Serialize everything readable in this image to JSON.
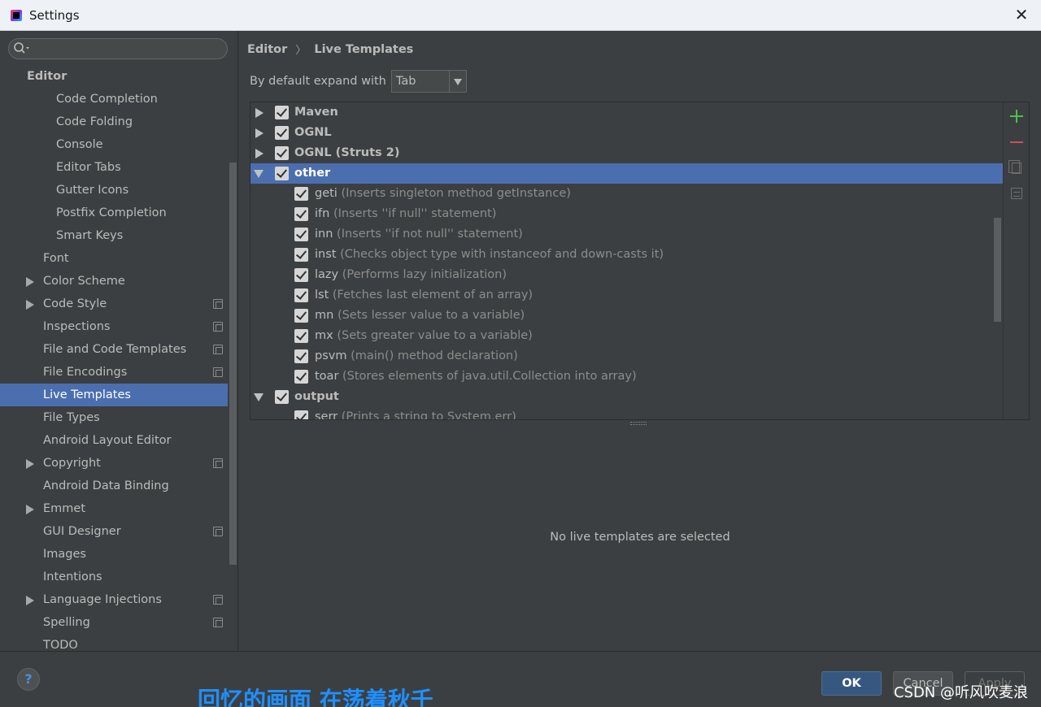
{
  "window": {
    "title": "Settings",
    "close_glyph": "✕"
  },
  "search": {
    "placeholder": ""
  },
  "sidebar": {
    "items": [
      {
        "label": "Editor",
        "kind": "header"
      },
      {
        "label": "Code Completion",
        "kind": "lvl2"
      },
      {
        "label": "Code Folding",
        "kind": "lvl2"
      },
      {
        "label": "Console",
        "kind": "lvl2"
      },
      {
        "label": "Editor Tabs",
        "kind": "lvl2"
      },
      {
        "label": "Gutter Icons",
        "kind": "lvl2"
      },
      {
        "label": "Postfix Completion",
        "kind": "lvl2"
      },
      {
        "label": "Smart Keys",
        "kind": "lvl2"
      },
      {
        "label": "Font",
        "kind": "lvl1"
      },
      {
        "label": "Color Scheme",
        "kind": "lvl1",
        "arrow": true
      },
      {
        "label": "Code Style",
        "kind": "lvl1",
        "arrow": true,
        "proj": true
      },
      {
        "label": "Inspections",
        "kind": "lvl1",
        "proj": true
      },
      {
        "label": "File and Code Templates",
        "kind": "lvl1",
        "proj": true
      },
      {
        "label": "File Encodings",
        "kind": "lvl1",
        "proj": true
      },
      {
        "label": "Live Templates",
        "kind": "lvl1",
        "selected": true
      },
      {
        "label": "File Types",
        "kind": "lvl1"
      },
      {
        "label": "Android Layout Editor",
        "kind": "lvl1"
      },
      {
        "label": "Copyright",
        "kind": "lvl1",
        "arrow": true,
        "proj": true
      },
      {
        "label": "Android Data Binding",
        "kind": "lvl1"
      },
      {
        "label": "Emmet",
        "kind": "lvl1",
        "arrow": true
      },
      {
        "label": "GUI Designer",
        "kind": "lvl1",
        "proj": true
      },
      {
        "label": "Images",
        "kind": "lvl1"
      },
      {
        "label": "Intentions",
        "kind": "lvl1"
      },
      {
        "label": "Language Injections",
        "kind": "lvl1",
        "arrow": true,
        "proj": true
      },
      {
        "label": "Spelling",
        "kind": "lvl1",
        "proj": true
      },
      {
        "label": "TODO",
        "kind": "lvl1"
      }
    ]
  },
  "breadcrumb": {
    "part1": "Editor",
    "sep": "〉",
    "part2": "Live Templates"
  },
  "expand": {
    "label": "By default expand with",
    "value": "Tab"
  },
  "templates": [
    {
      "type": "group",
      "name": "Maven",
      "expanded": false,
      "checked": true
    },
    {
      "type": "group",
      "name": "OGNL",
      "expanded": false,
      "checked": true
    },
    {
      "type": "group",
      "name": "OGNL (Struts 2)",
      "expanded": false,
      "checked": true
    },
    {
      "type": "group",
      "name": "other",
      "expanded": true,
      "checked": true,
      "selected": true
    },
    {
      "type": "item",
      "abbr": "geti",
      "desc": "(Inserts singleton method getInstance)",
      "checked": true
    },
    {
      "type": "item",
      "abbr": "ifn",
      "desc": "(Inserts ''if null'' statement)",
      "checked": true
    },
    {
      "type": "item",
      "abbr": "inn",
      "desc": "(Inserts ''if not null'' statement)",
      "checked": true
    },
    {
      "type": "item",
      "abbr": "inst",
      "desc": "(Checks object type with instanceof and down-casts it)",
      "checked": true
    },
    {
      "type": "item",
      "abbr": "lazy",
      "desc": "(Performs lazy initialization)",
      "checked": true
    },
    {
      "type": "item",
      "abbr": "lst",
      "desc": "(Fetches last element of an array)",
      "checked": true
    },
    {
      "type": "item",
      "abbr": "mn",
      "desc": "(Sets lesser value to a variable)",
      "checked": true
    },
    {
      "type": "item",
      "abbr": "mx",
      "desc": "(Sets greater value to a variable)",
      "checked": true
    },
    {
      "type": "item",
      "abbr": "psvm",
      "desc": "(main() method declaration)",
      "checked": true
    },
    {
      "type": "item",
      "abbr": "toar",
      "desc": "(Stores elements of java.util.Collection into array)",
      "checked": true
    },
    {
      "type": "group",
      "name": "output",
      "expanded": true,
      "checked": true
    },
    {
      "type": "item",
      "abbr": "serr",
      "desc": "(Prints a string to System.err)",
      "checked": true
    }
  ],
  "empty_message": "No live templates are selected",
  "buttons": {
    "ok": "OK",
    "cancel": "Cancel",
    "apply": "Apply",
    "help": "?"
  },
  "overlay": {
    "subtitle": "回忆的画面  在荡着秋千",
    "watermark": "CSDN @听风吹麦浪"
  },
  "colors": {
    "selection": "#4b6eaf",
    "background": "#3c3f41",
    "add": "#4fbd50",
    "remove": "#c75450",
    "ok_button": "#365880"
  },
  "icons": [
    "search-icon",
    "add-icon",
    "remove-icon",
    "copy-icon",
    "edit-icon",
    "help-icon",
    "close-icon",
    "project-icon"
  ]
}
